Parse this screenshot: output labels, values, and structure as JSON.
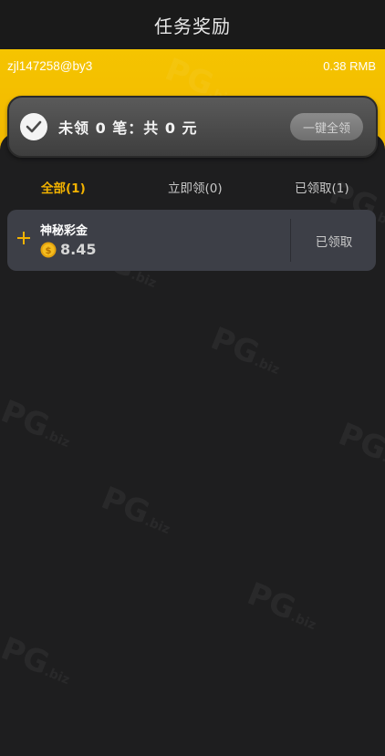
{
  "header": {
    "title": "任务奖励"
  },
  "account": {
    "id": "zjl147258@by3",
    "balance": "0.38 RMB"
  },
  "summary": {
    "text": "未领 0 笔：共 0 元",
    "claim_all_label": "一键全领"
  },
  "tabs": [
    {
      "label": "全部(1)",
      "active": true
    },
    {
      "label": "立即领(0)",
      "active": false
    },
    {
      "label": "已领取(1)",
      "active": false
    }
  ],
  "rewards": [
    {
      "name": "神秘彩金",
      "amount": "8.45",
      "status": "已领取",
      "icon": "coin-icon"
    }
  ],
  "watermark": {
    "text": "PG",
    "suffix": ".biz"
  },
  "colors": {
    "accent": "#f2b200",
    "band": "#f5c400",
    "card": "#3d3f47",
    "background": "#1a1a1a"
  }
}
